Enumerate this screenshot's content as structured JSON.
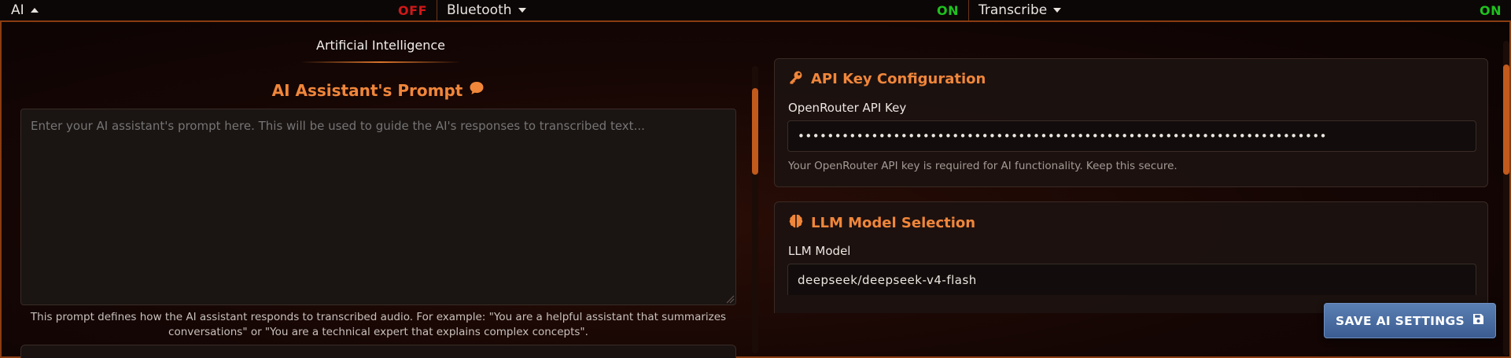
{
  "topbar": {
    "ai": {
      "label": "AI",
      "state": "OFF"
    },
    "bluetooth": {
      "label": "Bluetooth",
      "state": "ON"
    },
    "transcribe": {
      "label": "Transcribe",
      "state": "ON"
    }
  },
  "panel": {
    "tab_title": "Artificial Intelligence",
    "prompt": {
      "heading": "AI Assistant's Prompt",
      "placeholder": "Enter your AI assistant's prompt here. This will be used to guide the AI's responses to transcribed text...",
      "help_line1": "This prompt defines how the AI assistant responds to transcribed audio. For example: \"You are a helpful assistant that summarizes",
      "help_line2": "conversations\" or \"You are a technical expert that explains complex concepts\"."
    },
    "api_card": {
      "title": "API Key Configuration",
      "label": "OpenRouter API Key",
      "value": "••••••••••••••••••••••••••••••••••••••••••••••••••••••••••••••••••••••••",
      "help": "Your OpenRouter API key is required for AI functionality. Keep this secure."
    },
    "llm_card": {
      "title": "LLM Model Selection",
      "label": "LLM Model",
      "value": "deepseek/deepseek-v4-flash"
    },
    "save_button": "SAVE AI SETTINGS"
  },
  "icons": {
    "prompt": "speech-bubble-icon",
    "api": "key-icon",
    "llm": "brain-icon",
    "save": "floppy-disk-icon"
  },
  "colors": {
    "accent": "#f0863a",
    "off": "#d01818",
    "on": "#1ec21e",
    "border": "#8a3c12",
    "button": "#4a6da3"
  }
}
